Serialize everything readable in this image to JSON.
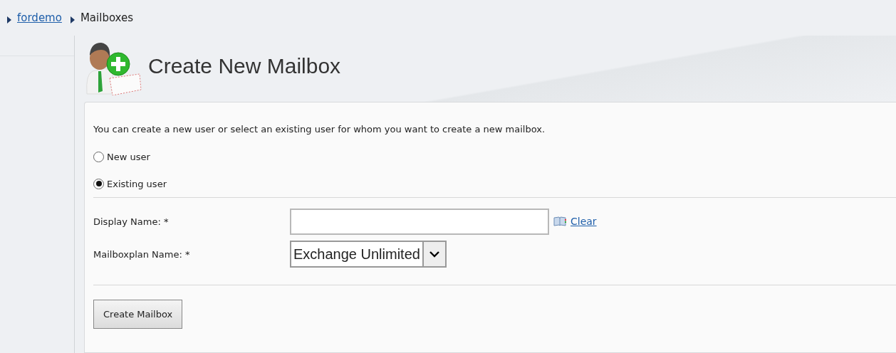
{
  "breadcrumb": [
    {
      "label": "fordemo",
      "kind": "link"
    },
    {
      "label": "Mailboxes",
      "kind": "current"
    }
  ],
  "title": "Create New Mailbox",
  "intro": "You can create a new user or select an existing user for whom you want to create a new mailbox.",
  "user_options": [
    {
      "label": "New user",
      "selected": false
    },
    {
      "label": "Existing user",
      "selected": true
    }
  ],
  "fields": [
    {
      "kind": "text",
      "label": "Display Name: *",
      "link": "Clear"
    },
    {
      "kind": "select",
      "label": "Mailboxplan Name: *",
      "value": "Exchange Unlimited"
    }
  ],
  "buttons": [
    "Create Mailbox"
  ]
}
